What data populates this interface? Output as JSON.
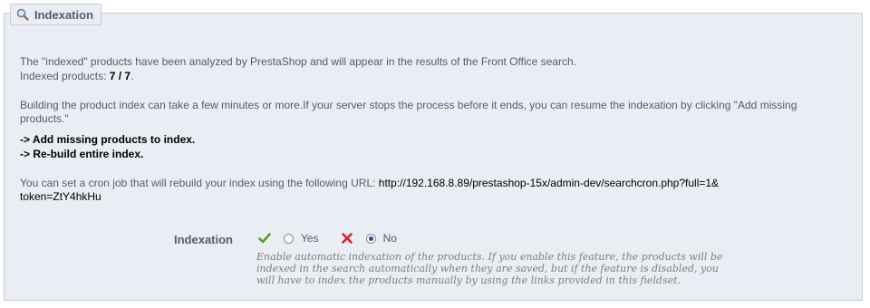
{
  "panel": {
    "legend_title": "Indexation",
    "legend_icon": "search-icon"
  },
  "info": {
    "analyzed_text": "The \"indexed\" products have been analyzed by PrestaShop and will appear in the results of the Front Office search.",
    "indexed_label": "Indexed products: ",
    "indexed_value": "7 / 7",
    "indexed_suffix": ".",
    "build_note": "Building the product index can take a few minutes or more.If your server stops the process before it ends, you can resume the indexation by clicking \"Add missing products.\"",
    "arrow": "-> ",
    "add_missing_label": "Add missing products to index.",
    "rebuild_label": "Re-build entire index.",
    "cron_text": "You can set a cron job that will rebuild your index using the following URL: ",
    "cron_url_line1": "http://192.168.8.89/prestashop-15x/admin-dev/searchcron.php?full=1&",
    "cron_url_line2": "token=ZtY4hkHu"
  },
  "form": {
    "indexation_label": "Indexation",
    "yes_label": "Yes",
    "no_label": "No",
    "yes_icon": "checkmark-icon",
    "no_icon": "cross-icon",
    "selected": "No",
    "hint": "Enable automatic indexation of the products. If you enable this feature, the products will be indexed in the search automatically when they are saved, but if the feature is disabled, you will have to index the products manually by using the links provided in this fieldset."
  },
  "colors": {
    "panel_bg": "#ebedf4",
    "border": "#ccced7",
    "text": "#585a69",
    "link": "#000000",
    "check_green": "#4aa524",
    "cross_red": "#d2232a"
  }
}
